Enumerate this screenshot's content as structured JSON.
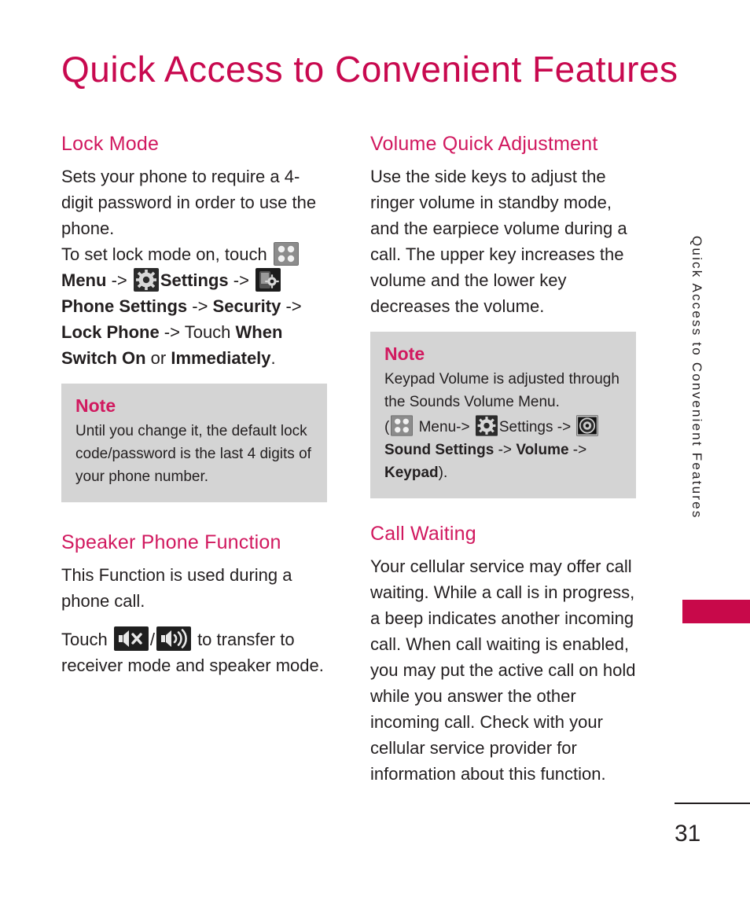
{
  "page": {
    "title": "Quick Access to Convenient Features",
    "number": "31",
    "side_tab_label": "Quick Access to Convenient Features",
    "accent_color": "#c8094f",
    "note_bg_color": "#d4d4d4",
    "tab_marker_color": "#c8094a"
  },
  "left_column": {
    "lock_mode": {
      "heading": "Lock Mode",
      "para1": "Sets your phone to require a 4-digit password in order to use the phone.",
      "instr_prefix": "To set lock mode on, touch ",
      "instr_menu": "Menu",
      "instr_arrow1": " -> ",
      "instr_settings": "Settings",
      "instr_arrow2": " -> ",
      "instr_phone_settings": "Phone Settings",
      "instr_arrow3": " -> ",
      "instr_security": "Security",
      "instr_arrow4": " -> ",
      "instr_lock_phone": "Lock Phone",
      "instr_arrow5": " -> ",
      "instr_touch": "Touch ",
      "instr_when_switch_on": "When Switch On",
      "instr_or": " or ",
      "instr_immediately": "Immediately",
      "instr_period": ".",
      "note_title": "Note",
      "note_body": "Until you change it, the default lock code/password is the last 4 digits of your phone number."
    },
    "speaker_phone": {
      "heading": "Speaker Phone Function",
      "para1": "This Function is used during a phone call.",
      "touch_prefix": "Touch ",
      "touch_slash": "/",
      "touch_suffix": " to transfer to receiver mode and speaker mode."
    }
  },
  "right_column": {
    "volume_quick": {
      "heading": "Volume Quick Adjustment",
      "para1": "Use the side keys to adjust the ringer volume in standby mode, and the earpiece volume during a call. The upper key increases the volume and the lower key decreases the volume.",
      "note_title": "Note",
      "note_line1": "Keypad Volume is adjusted through the Sounds Volume Menu.",
      "note_open_paren": "(",
      "note_menu": " Menu-> ",
      "note_settings": "Settings",
      "note_arrow1": " -> ",
      "note_sound_settings": "Sound Settings",
      "note_arrow2": " -> ",
      "note_volume": "Volume",
      "note_arrow3": " -> ",
      "note_keypad": "Keypad",
      "note_close_paren": ")."
    },
    "call_waiting": {
      "heading": "Call Waiting",
      "para1": "Your cellular service may offer call waiting. While a call is in progress, a beep indicates another incoming call. When call waiting is enabled, you may put the active call on hold while you answer the other incoming call. Check with your cellular service provider for information about this function."
    }
  },
  "icons": {
    "menu": "menu-grid-icon",
    "settings": "settings-gear-icon",
    "phone_settings": "phone-settings-icon",
    "sound_settings": "sound-speaker-icon",
    "speaker_mute": "speaker-mute-icon",
    "speaker_on": "speaker-on-icon"
  }
}
